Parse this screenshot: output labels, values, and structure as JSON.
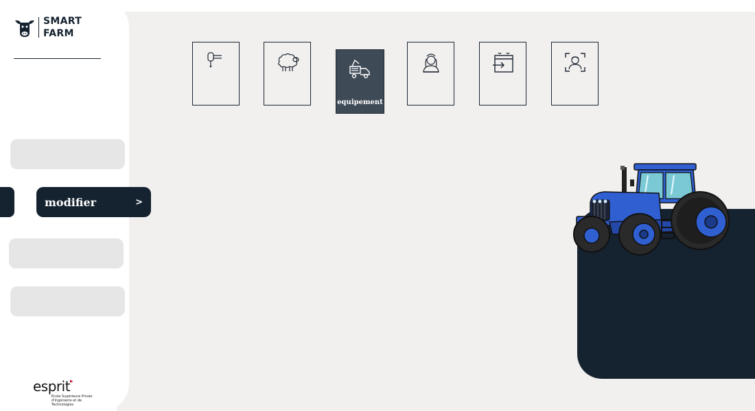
{
  "brand": {
    "line1": "SMART",
    "line2": "FARM"
  },
  "sidebar": {
    "active_label": "modifier",
    "active_chevron": ">"
  },
  "tiles": [
    {
      "icon": "feeder-icon"
    },
    {
      "icon": "sheep-icon"
    },
    {
      "icon": "equipment-truck-icon",
      "label": "equipement",
      "active": true
    },
    {
      "icon": "farmer-woman-icon"
    },
    {
      "icon": "calendar-login-icon"
    },
    {
      "icon": "face-scan-icon"
    }
  ],
  "footer": {
    "brand": "esprit",
    "tagline_1": "Ecole Supérieure Privée",
    "tagline_2": "d'Ingénierie et de Technologies"
  },
  "colors": {
    "navy": "#15222f",
    "tile_active": "#3f4a57",
    "background": "#f1f0ef",
    "tractor_blue": "#2f5fd0"
  }
}
